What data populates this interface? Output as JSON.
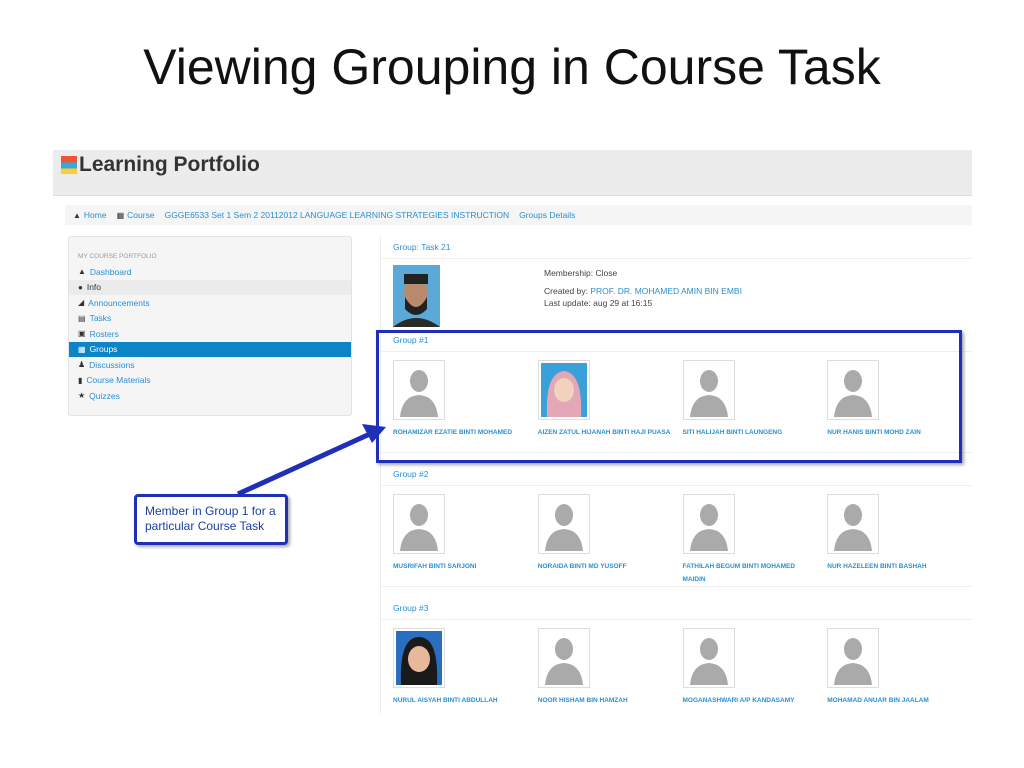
{
  "slide_title": "Viewing Grouping in Course Task",
  "app": {
    "title": "Learning Portfolio"
  },
  "breadcrumb": [
    {
      "label": "Home",
      "icon": "home-icon"
    },
    {
      "label": "Course",
      "icon": "grid-icon"
    },
    {
      "label": "GGGE6533 Set 1 Sem 2 20112012 LANGUAGE LEARNING STRATEGIES INSTRUCTION"
    },
    {
      "label": "Groups Details"
    }
  ],
  "sidebar": {
    "heading": "MY COURSE PORTFOLIO",
    "items": [
      {
        "label": "Dashboard",
        "icon": "home-icon"
      },
      {
        "label": "Info",
        "icon": "info-icon"
      },
      {
        "label": "Announcements",
        "icon": "signal-icon"
      },
      {
        "label": "Tasks",
        "icon": "list-icon"
      },
      {
        "label": "Rosters",
        "icon": "calendar-icon"
      },
      {
        "label": "Groups",
        "icon": "grid-icon"
      },
      {
        "label": "Discussions",
        "icon": "user-icon"
      },
      {
        "label": "Course Materials",
        "icon": "book-icon"
      },
      {
        "label": "Quizzes",
        "icon": "star-icon"
      }
    ]
  },
  "task": {
    "title": "Group: Task 21",
    "membership": "Membership: Close",
    "created_by_label": "Created by:",
    "created_by": "PROF. DR. MOHAMED AMIN BIN EMBI",
    "last_update": "Last update: aug 29 at 16:15"
  },
  "groups": [
    {
      "title": "Group #1",
      "members": [
        "ROHAMIZAR EZATIE BINTI MOHAMED",
        "AIZEN ZATUL HIJANAH BINTI HAJI PUASA",
        "SITI HALIJAH BINTI LAUNGENG",
        "NUR HANIS BINTI MOHD ZAIN"
      ]
    },
    {
      "title": "Group #2",
      "members": [
        "MUSRIFAH BINTI SARJONI",
        "NORAIDA BINTI MD YUSOFF",
        "FATHILAH BEGUM BINTI MOHAMED MAIDIN",
        "NUR HAZELEEN BINTI BASHAH"
      ]
    },
    {
      "title": "Group #3",
      "members": [
        "NURUL AISYAH BINTI ABDULLAH",
        "NOOR HISHAM BIN HAMZAH",
        "MOGANASHWARI A/P KANDASAMY",
        "MOHAMAD ANUAR BIN JAALAM"
      ]
    }
  ],
  "callout": "Member in Group 1 for a particular Course Task",
  "colors": {
    "link": "#2a8fd1",
    "active": "#0b84c8",
    "annotation": "#1f2fb8"
  }
}
